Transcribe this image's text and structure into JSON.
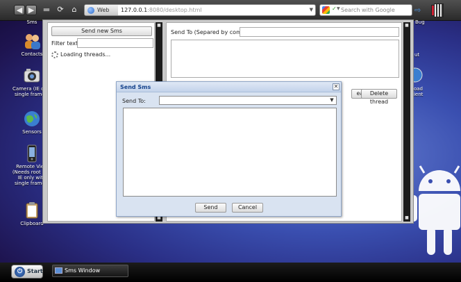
{
  "browser": {
    "url_tab_label": "Web",
    "url_host": "127.0.0.1",
    "url_rest": ":8080/desktop.html",
    "search_placeholder": "Search with Google"
  },
  "desktop": {
    "icons": [
      {
        "label": "Sms"
      },
      {
        "label": "Contacts"
      },
      {
        "label": "Camera (IE only single frames)"
      },
      {
        "label": "Sensors"
      },
      {
        "label": "Remote View (Needs root and IE only with single frames)"
      },
      {
        "label": "Clipboard"
      }
    ],
    "right_labels": [
      "Bug",
      "ut",
      "load lient"
    ]
  },
  "sms_window": {
    "new_sms_button": "Send new Sms",
    "filter_label": "Filter text:",
    "loading_text": "Loading threads...",
    "send_to_label": "Send To (Separed by comma):",
    "mark_read_button": "eaded",
    "delete_thread_button": "Delete thread"
  },
  "dialog": {
    "title": "Send Sms",
    "close": "✕",
    "send_to_label": "Send To:",
    "send_button": "Send",
    "cancel_button": "Cancel"
  },
  "taskbar": {
    "start_label": "Start",
    "window_label": "Sms Window"
  },
  "colors": {
    "dialog_title": "#15428b",
    "dialog_bg": "#d9e3f1",
    "desktop_bg": "#2a2f86"
  }
}
